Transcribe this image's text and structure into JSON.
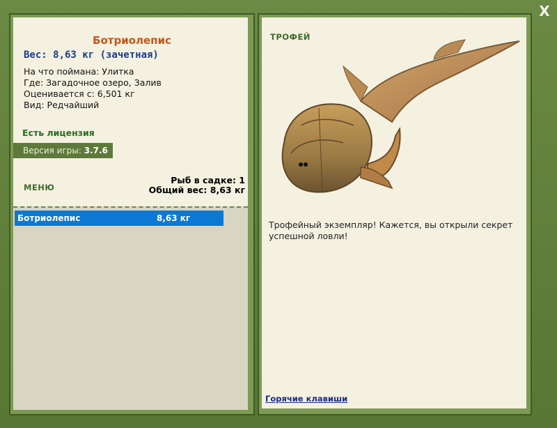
{
  "window": {
    "close_label": "X"
  },
  "fish": {
    "name": "Ботриолепис",
    "weight_line": "Вес: 8,63 кг (зачетная)",
    "caught_on": "На что поймана: Улитка",
    "location": "Где: Загадочное озеро, Залив",
    "valued_from": "Оценивается с: 6,501 кг",
    "kind": "Вид: Редчайший"
  },
  "license": "Есть лицензия",
  "version": {
    "label": "Версия игры:",
    "value": "3.7.6"
  },
  "menu_label": "МЕНЮ",
  "keepnet": {
    "fish_count": "Рыб в садке: 1",
    "total_weight": "Общий вес: 8,63 кг",
    "items": [
      {
        "name": "Ботриолепис",
        "weight": "8,63 кг"
      }
    ]
  },
  "trophy": {
    "label": "ТРОФЕЙ",
    "description": "Трофейный экземпляр! Кажется, вы открыли секрет успешной ловли!",
    "hotkeys_link": "Горячие клавиши"
  },
  "colors": {
    "frame": "#5d7a3a",
    "panel_bg": "#f4f1e1",
    "fish_name": "#c1581a",
    "weight": "#1c3c8c",
    "license": "#2a6e1e",
    "selection": "#0b78d4"
  },
  "icons": {
    "close": "close-icon"
  }
}
